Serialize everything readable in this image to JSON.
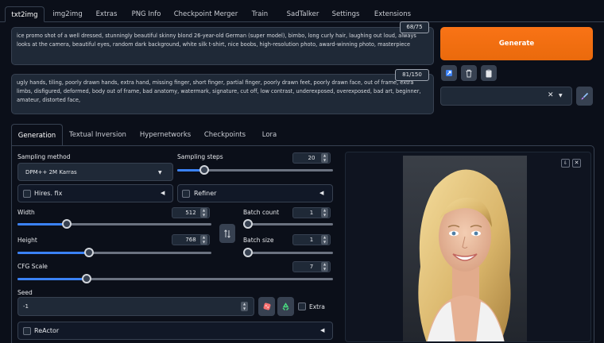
{
  "top_tabs": [
    "txt2img",
    "img2img",
    "Extras",
    "PNG Info",
    "Checkpoint Merger",
    "Train",
    "SadTalker",
    "Settings",
    "Extensions"
  ],
  "prompt": {
    "text": "ice promo shot of a well dressed, stunningly beautiful skinny blond  26-year-old German (super model), bimbo, long curly hair, laughing out loud, always looks at the camera, beautiful eyes, random dark background, white silk t-shirt, nice boobs, high-resolution photo, award-winning photo, masterpiece",
    "counter": "68/75"
  },
  "negative": {
    "text": "ugly hands, tiling, poorly drawn hands, extra hand, missing finger, short finger, partial finger, poorly drawn feet, poorly drawn face, out of frame, extra limbs, disfigured, deformed, body out of frame, bad anatomy, watermark, signature, cut off, low contrast, underexposed, overexposed, bad art, beginner, amateur, distorted face,",
    "counter": "81/150"
  },
  "generate_label": "Generate",
  "sub_tabs": [
    "Generation",
    "Textual Inversion",
    "Hypernetworks",
    "Checkpoints",
    "Lora"
  ],
  "sampling_method": {
    "label": "Sampling method",
    "value": "DPM++ 2M Karras"
  },
  "sampling_steps": {
    "label": "Sampling steps",
    "value": "20",
    "fraction": 0.15
  },
  "hires_label": "Hires. fix",
  "refiner_label": "Refiner",
  "width": {
    "label": "Width",
    "value": "512",
    "fraction": 0.24
  },
  "height": {
    "label": "Height",
    "value": "768",
    "fraction": 0.36
  },
  "batch_count": {
    "label": "Batch count",
    "value": "1",
    "fraction": 0.0
  },
  "batch_size": {
    "label": "Batch size",
    "value": "1",
    "fraction": 0.0
  },
  "cfg_scale": {
    "label": "CFG Scale",
    "value": "7",
    "fraction": 0.21
  },
  "seed": {
    "label": "Seed",
    "value": "-1"
  },
  "extra_label": "Extra",
  "reactor_label": "ReActor",
  "colors": {
    "accent": "#f97316",
    "slider": "#3b82f6",
    "background": "#0b0f19"
  }
}
